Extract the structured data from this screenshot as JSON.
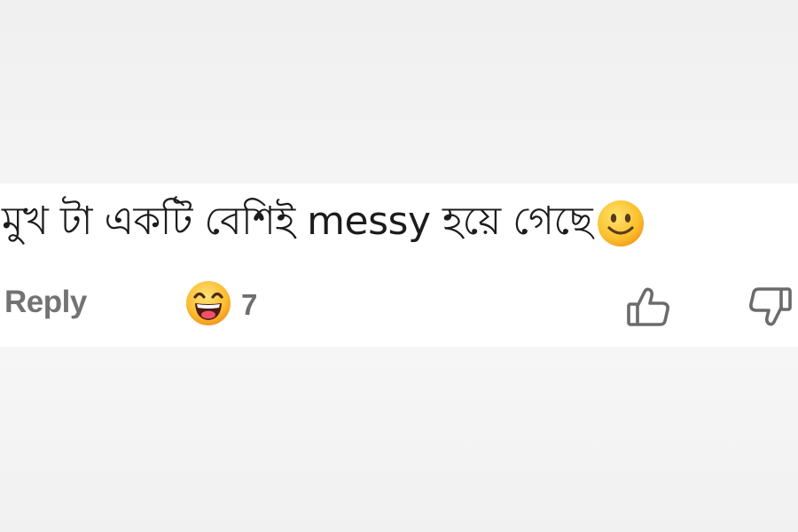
{
  "comment": {
    "text": "মুখ টা একটি বেশিই messy হয়ে গেছে",
    "trailing_emoji": "slightly-smiling-face"
  },
  "actions": {
    "reply_label": "Reply",
    "reaction": {
      "emoji": "grinning-squinting-face",
      "count": "7"
    },
    "upvote_icon": "thumbs-up-outline-icon",
    "downvote_icon": "thumbs-down-outline-icon"
  },
  "colors": {
    "page_background": "#f2f2f2",
    "card_background": "#ffffff",
    "text_primary": "#1c1c1c",
    "text_secondary": "#737373",
    "icon_stroke": "#6b6b6b"
  }
}
